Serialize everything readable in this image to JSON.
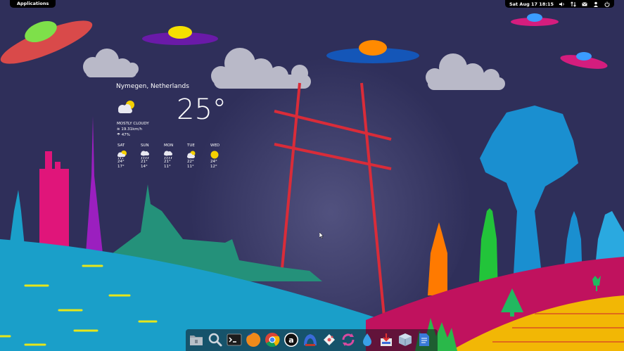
{
  "panel": {
    "applications_label": "Applications",
    "clock": "Sat Aug 17 18:15",
    "tray_icons": [
      "volume-icon",
      "network-icon",
      "mail-icon",
      "user-icon",
      "power-icon"
    ]
  },
  "weather": {
    "location": "Nymegen, Netherlands",
    "temperature": "25°",
    "condition": "MOSTLY CLOUDY",
    "wind": "19.31km/h",
    "humidity": "47%",
    "forecast": [
      {
        "day": "SAT",
        "icon": "rain-sun-icon",
        "high": "24°",
        "low": "17°"
      },
      {
        "day": "SUN",
        "icon": "rain-icon",
        "high": "21°",
        "low": "14°"
      },
      {
        "day": "MON",
        "icon": "rain-icon",
        "high": "21°",
        "low": "11°"
      },
      {
        "day": "TUE",
        "icon": "cloud-sun-icon",
        "high": "22°",
        "low": "11°"
      },
      {
        "day": "WED",
        "icon": "sun-icon",
        "high": "24°",
        "low": "12°"
      }
    ]
  },
  "dock": {
    "items": [
      "files-icon",
      "search-icon",
      "terminal-icon",
      "firefox-icon",
      "chrome-icon",
      "amazon-icon",
      "pantheon-icon",
      "gitg-icon",
      "sync-icon",
      "drop-icon",
      "installer-icon",
      "box-icon",
      "document-icon"
    ]
  },
  "colors": {
    "sky": "#2f2f5a",
    "sea": "#1a9fc9",
    "magenta_hill": "#c0125e",
    "yellow_field": "#f2b705",
    "beam": "#d92c39"
  }
}
